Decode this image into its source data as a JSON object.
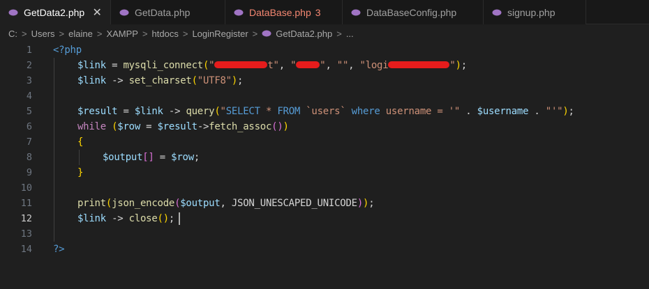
{
  "tabs": [
    {
      "label": "GetData2.php",
      "active": true
    },
    {
      "label": "GetData.php"
    },
    {
      "label": "DataBase.php",
      "errors": "3"
    },
    {
      "label": "DataBaseConfig.php"
    },
    {
      "label": "signup.php"
    }
  ],
  "tab_close_glyph": "✕",
  "breadcrumb": [
    "C:",
    "Users",
    "elaine",
    "XAMPP",
    "htdocs",
    "LoginRegister",
    "GetData2.php",
    "..."
  ],
  "breadcrumb_sep": ">",
  "line_numbers": [
    "1",
    "2",
    "3",
    "4",
    "5",
    "6",
    "7",
    "8",
    "9",
    "10",
    "11",
    "12",
    "13",
    "14"
  ],
  "current_line": "12",
  "code": {
    "l1": "<?php",
    "l2_var": "$link",
    "l2_eq": " = ",
    "l2_fn": "mysqli_connect",
    "l2_open": "(",
    "l2_s1a": "\"",
    "l2_s1b": "t\"",
    "l2_c1": ", ",
    "l2_s2a": "\"",
    "l2_s2b": "\"",
    "l2_c2": ", ",
    "l2_s3": "\"\"",
    "l2_c3": ", ",
    "l2_s4a": "\"logi",
    "l2_s4b": "\"",
    "l2_close": ")",
    "l2_semi": ";",
    "l3_var": "$link",
    "l3_arrow": " -> ",
    "l3_fn": "set_charset",
    "l3_open": "(",
    "l3_str": "\"UTF8\"",
    "l3_close": ")",
    "l3_semi": ";",
    "l5_var": "$result",
    "l5_eq": " = ",
    "l5_var2": "$link",
    "l5_arrow": " -> ",
    "l5_fn": "query",
    "l5_open": "(",
    "l5_s1": "\"",
    "l5_sql1": "SELECT",
    "l5_s2": " * ",
    "l5_sql2": "FROM",
    "l5_s3": " `users` ",
    "l5_sql3": "where",
    "l5_s4": " username = '\"",
    "l5_dot1": " . ",
    "l5_var3": "$username",
    "l5_dot2": " . ",
    "l5_s5": "\"'\"",
    "l5_close": ")",
    "l5_semi": ";",
    "l6_kw": "while",
    "l6_sp": " ",
    "l6_open": "(",
    "l6_var": "$row",
    "l6_eq": " = ",
    "l6_var2": "$result",
    "l6_arrow": "->",
    "l6_fn": "fetch_assoc",
    "l6_open2": "(",
    "l6_close2": ")",
    "l6_close": ")",
    "l7": "{",
    "l8_var": "$output",
    "l8_idx": "[]",
    "l8_eq": " = ",
    "l8_var2": "$row",
    "l8_semi": ";",
    "l9": "}",
    "l11_fn": "print",
    "l11_open": "(",
    "l11_fn2": "json_encode",
    "l11_open2": "(",
    "l11_var": "$output",
    "l11_comma": ", ",
    "l11_const": "JSON_UNESCAPED_UNICODE",
    "l11_close2": ")",
    "l11_close": ")",
    "l11_semi": ";",
    "l12_var": "$link",
    "l12_arrow": " -> ",
    "l12_fn": "close",
    "l12_open": "(",
    "l12_close": ")",
    "l12_semi": ";",
    "l14": "?>"
  },
  "colors": {
    "background": "#1f1f1f",
    "keyword": "#569cd6",
    "variable": "#9cdcfe",
    "function": "#dcdcaa",
    "string": "#ce9178",
    "control": "#c586c0",
    "bracket_gold": "#ffd700",
    "bracket_purple": "#da70d6",
    "bracket_blue": "#179fff",
    "error": "#f48771",
    "redaction": "#e51c1c"
  }
}
